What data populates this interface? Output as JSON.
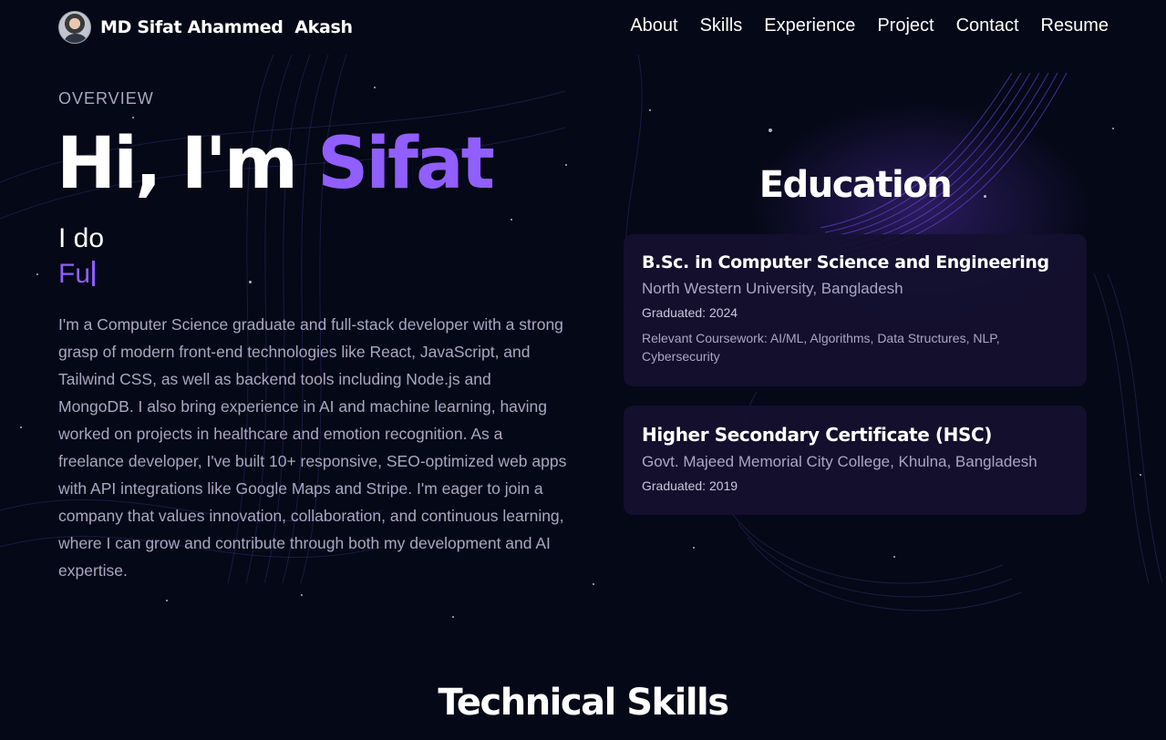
{
  "navbar": {
    "name": "MD Sifat Ahammed  Akash",
    "links": [
      "About",
      "Skills",
      "Experience",
      "Project",
      "Contact",
      "Resume"
    ]
  },
  "hero": {
    "overline": "OVERVIEW",
    "greeting": "Hi, I'm ",
    "name": "Sifat",
    "i_do": "I do",
    "typed_text": "Fu",
    "bio": "I'm a Computer Science graduate and full-stack developer with a strong grasp of modern front-end technologies like React, JavaScript, and Tailwind CSS, as well as backend tools including Node.js and MongoDB. I also bring experience in AI and machine learning, having worked on projects in healthcare and emotion recognition. As a freelance developer, I've built 10+ responsive, SEO-optimized web apps with API integrations like Google Maps and Stripe. I'm eager to join a company that values innovation, collaboration, and continuous learning, where I can grow and contribute through both my development and AI expertise."
  },
  "education": {
    "title": "Education",
    "items": [
      {
        "degree": "B.Sc. in Computer Science and Engineering",
        "school": "North Western University, Bangladesh",
        "graduated": "Graduated: 2024",
        "coursework": "Relevant Coursework: AI/ML, Algorithms, Data Structures, NLP, Cybersecurity"
      },
      {
        "degree": "Higher Secondary Certificate (HSC)",
        "school": "Govt. Majeed Memorial City College, Khulna, Bangladesh",
        "graduated": "Graduated: 2019"
      }
    ]
  },
  "skills": {
    "title": "Technical Skills"
  },
  "colors": {
    "background": "#050816",
    "accent": "#915eff",
    "muted_text": "#aaa6c3",
    "card": "#151030"
  },
  "icons": {
    "avatar": "profile-photo"
  }
}
